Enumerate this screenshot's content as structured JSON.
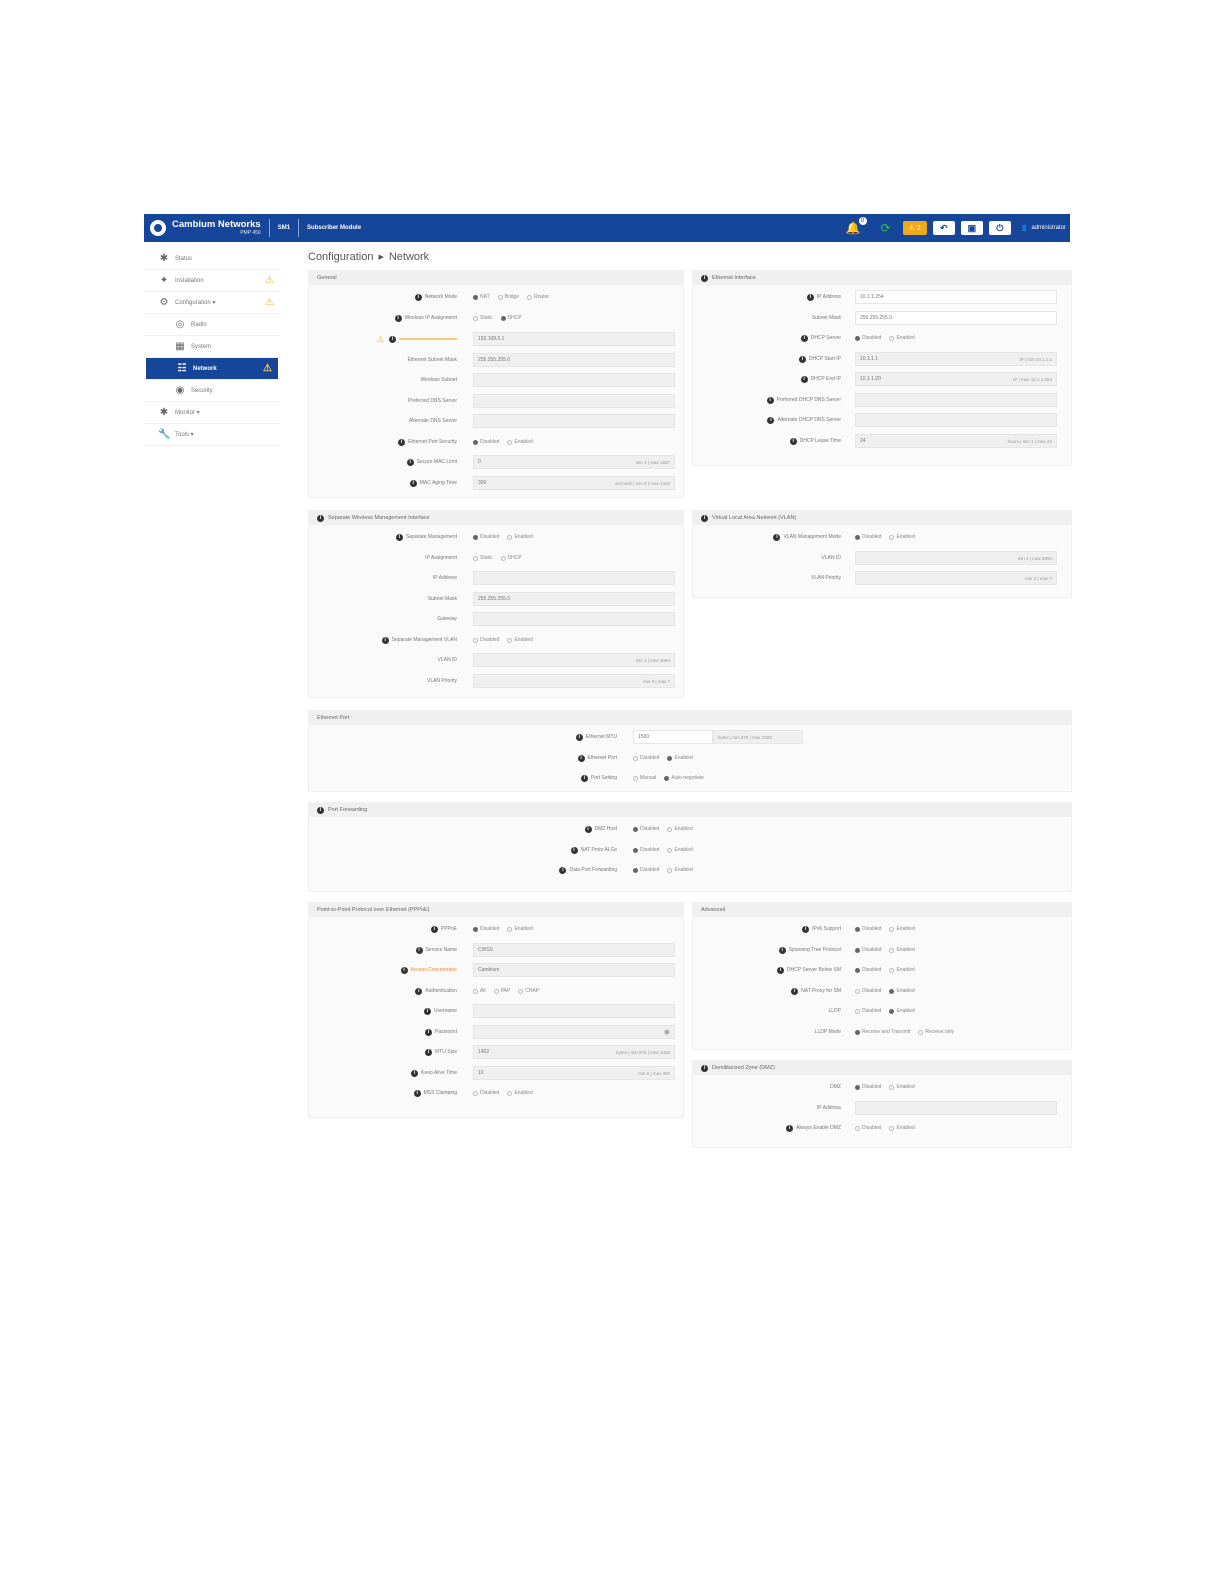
{
  "topbar": {
    "brand": "Cambium Networks",
    "model": "PMP 450",
    "device": "SM1",
    "site": "Subscriber Module",
    "bell_count": "0",
    "warn_count": "2",
    "user": "administrator",
    "colors": {
      "bar": "#16469a",
      "warn": "#f0a81c",
      "sync": "#3fbf3f"
    }
  },
  "sidebar": {
    "items": [
      {
        "label": "Status",
        "icon": "status-icon"
      },
      {
        "label": "Installation",
        "icon": "installation-icon",
        "warn": true
      },
      {
        "label": "Configuration",
        "icon": "gear-icon",
        "warn": true
      },
      {
        "label": "Radio",
        "icon": "radio-icon"
      },
      {
        "label": "System",
        "icon": "system-icon"
      },
      {
        "label": "Network",
        "icon": "network-icon",
        "warn": true,
        "active": true
      },
      {
        "label": "Security",
        "icon": "security-icon"
      },
      {
        "label": "Monitor",
        "icon": "monitor-icon"
      },
      {
        "label": "Tools",
        "icon": "tools-icon"
      }
    ]
  },
  "breadcrumb": {
    "section": "Configuration",
    "page": "Network"
  },
  "general": {
    "title": "General",
    "network_mode": {
      "label": "Network Mode",
      "options": [
        "NAT",
        "Bridge",
        "Router"
      ],
      "selected": 0
    },
    "wireless_ip": {
      "label": "Wireless IP Assignment",
      "options": [
        "Static",
        "DHCP"
      ],
      "selected": 1
    },
    "ip_address": {
      "value": "192.168.0.1"
    },
    "ethernet_subnet": {
      "label": "Ethernet Subnet Mask",
      "value": "255.255.255.0"
    },
    "wireless_subnet": {
      "label": "Wireless Subnet",
      "value": ""
    },
    "preferred_dns": {
      "label": "Preferred DNS Server",
      "value": ""
    },
    "alternate_dns": {
      "label": "Alternate DNS Server",
      "value": ""
    },
    "eth_port_sec": {
      "label": "Ethernet Port Security",
      "options": [
        "Disabled",
        "Enabled"
      ],
      "selected": 0
    },
    "secure_mac": {
      "label": "Secure MAC Limit",
      "value": "0",
      "hint": "min 1 | max 1667"
    },
    "mac_aging": {
      "label": "MAC Aging Time",
      "value": "300",
      "hint": "seconds | min 0 | max 1440"
    }
  },
  "eth_interface": {
    "title": "Ethernet Interface",
    "ip": {
      "label": "IP Address",
      "value": "10.1.1.254"
    },
    "subnet": {
      "label": "Subnet Mask",
      "value": "255.255.255.0"
    },
    "dhcp_server": {
      "label": "DHCP Server",
      "options": [
        "Disabled",
        "Enabled"
      ],
      "selected": 0
    },
    "dhcp_start": {
      "label": "DHCP Start IP",
      "value": "10.1.1.1",
      "hint": "IP | min 10.1.1.1"
    },
    "dhcp_end": {
      "label": "DHCP End IP",
      "value": "10.1.1.20",
      "hint": "IP | max 10.1.1.254"
    },
    "pref_dhcp_dns": {
      "label": "Preferred DHCP DNS Server",
      "value": ""
    },
    "alt_dhcp_dns": {
      "label": "Alternate DHCP DNS Server",
      "value": ""
    },
    "lease": {
      "label": "DHCP Lease Time",
      "value": "24",
      "hint": "hours | min 1 | max 24"
    }
  },
  "swmi": {
    "title": "Separate Wireless Management Interface",
    "sep_mgmt": {
      "label": "Separate Management",
      "options": [
        "Disabled",
        "Enabled"
      ],
      "selected": 0
    },
    "ip_assign": {
      "label": "IP Assignment",
      "options": [
        "Static",
        "DHCP"
      ],
      "selected": -1
    },
    "ip": {
      "label": "IP Address",
      "value": ""
    },
    "subnet": {
      "label": "Subnet Mask",
      "value": "255.255.255.0"
    },
    "gateway": {
      "label": "Gateway",
      "value": ""
    },
    "sep_vlan": {
      "label": "Separate Management VLAN",
      "options": [
        "Disabled",
        "Enabled"
      ],
      "selected": -1
    },
    "vlan_id": {
      "label": "VLAN ID",
      "value": "",
      "hint": "min 1 | max 4094"
    },
    "vlan_priority": {
      "label": "VLAN Priority",
      "value": "",
      "hint": "min 0 | max 7"
    }
  },
  "vlan": {
    "title": "Virtual Local Area Network (VLAN)",
    "mgmt": {
      "label": "VLAN Management Mode",
      "options": [
        "Disabled",
        "Enabled"
      ],
      "selected": 0
    },
    "id": {
      "label": "VLAN ID",
      "value": "",
      "hint": "min 1 | max 4094"
    },
    "priority": {
      "label": "VLAN Priority",
      "value": "",
      "hint": "min 0 | max 7"
    }
  },
  "eth_port": {
    "title": "Ethernet Port",
    "mtu": {
      "label": "Ethernet MTU",
      "value": "1500",
      "hint": "bytes | min 576 | max 2000"
    },
    "port": {
      "label": "Ethernet Port",
      "options": [
        "Disabled",
        "Enabled"
      ],
      "selected": 1
    },
    "setting": {
      "label": "Port Setting",
      "options": [
        "Manual",
        "Auto-negotiate"
      ],
      "selected": 1
    }
  },
  "port_fwd": {
    "title": "Port Forwarding",
    "dmz": {
      "label": "DMZ Host",
      "options": [
        "Disabled",
        "Enabled"
      ],
      "selected": 0
    },
    "nat_alg": {
      "label": "NAT Proto ALGs",
      "options": [
        "Disabled",
        "Enabled"
      ],
      "selected": 0
    },
    "data_fwd": {
      "label": "Data Port Forwarding",
      "options": [
        "Disabled",
        "Enabled"
      ],
      "selected": 0
    }
  },
  "pppoe": {
    "title": "Point-to-Point Protocol over Ethernet (PPPoE)",
    "pppoe": {
      "label": "PPPoE",
      "options": [
        "Disabled",
        "Enabled"
      ],
      "selected": 0
    },
    "service": {
      "label": "Service Name",
      "value": "CWSS"
    },
    "access": {
      "label": "Access Concentrator",
      "value": "Cambium"
    },
    "auth": {
      "label": "Authentication",
      "options": [
        "All",
        "PAP",
        "CHAP"
      ],
      "selected": -1
    },
    "username": {
      "label": "Username",
      "value": ""
    },
    "password": {
      "label": "Password",
      "value": ""
    },
    "mtu": {
      "label": "MTU Size",
      "value": "1492",
      "hint": "bytes | min 576 | max 1492"
    },
    "keepalive": {
      "label": "Keep Alive Time",
      "value": "10",
      "hint": "min 0 | max 300"
    },
    "mss": {
      "label": "MSS Clamping",
      "options": [
        "Disabled",
        "Enabled"
      ],
      "selected": -1
    }
  },
  "advanced": {
    "title": "Advanced",
    "ipv6": {
      "label": "IPv6 Support",
      "options": [
        "Disabled",
        "Enabled"
      ],
      "selected": 0
    },
    "stp": {
      "label": "Spanning Tree Protocol",
      "options": [
        "Disabled",
        "Enabled"
      ],
      "selected": 0
    },
    "dhcp_below": {
      "label": "DHCP Server Below SM",
      "options": [
        "Disabled",
        "Enabled"
      ],
      "selected": 0
    },
    "nat_proxy": {
      "label": "NAT Proxy for SM",
      "options": [
        "Disabled",
        "Enabled"
      ],
      "selected": 1
    },
    "lldp": {
      "label": "LLDP",
      "options": [
        "Disabled",
        "Enabled"
      ],
      "selected": 1
    },
    "lldp_mode": {
      "label": "LLDP Mode",
      "options": [
        "Receive and Transmit",
        "Receive only"
      ],
      "selected": 0
    }
  },
  "dmz": {
    "title": "Demilitarized Zone (DMZ)",
    "dmz": {
      "label": "DMZ",
      "options": [
        "Disabled",
        "Enabled"
      ],
      "selected": 0
    },
    "ip": {
      "label": "IP Address",
      "value": ""
    },
    "always": {
      "label": "Always Enable DMZ",
      "options": [
        "Disabled",
        "Enabled"
      ],
      "selected": -1
    }
  }
}
